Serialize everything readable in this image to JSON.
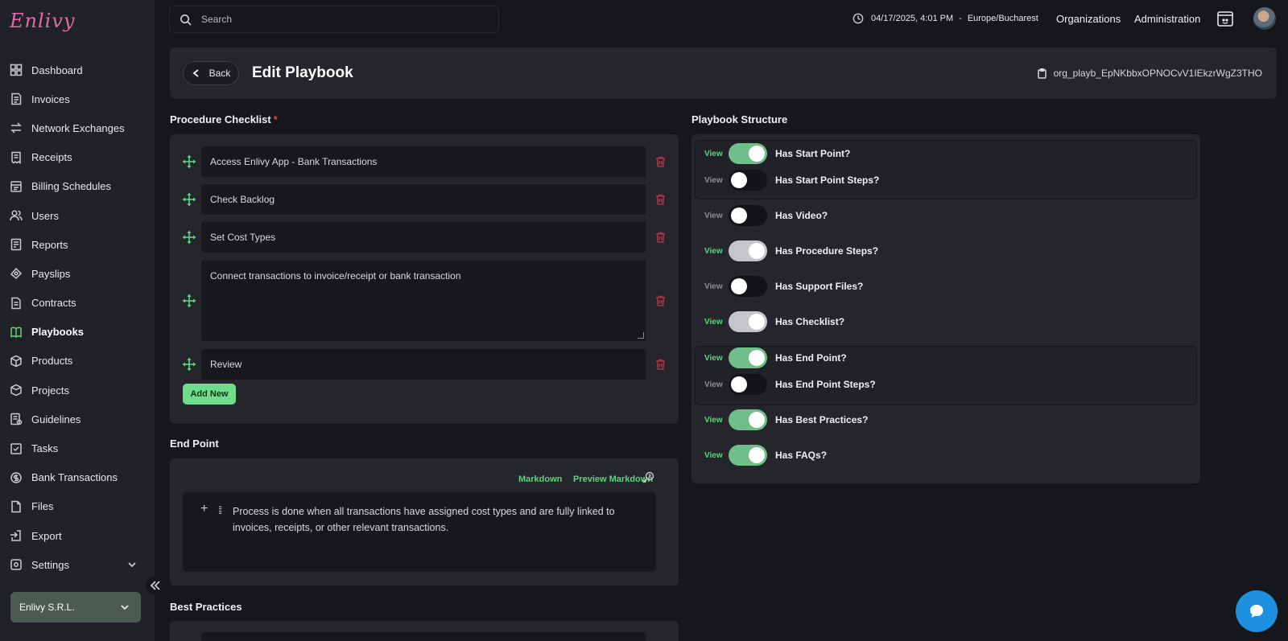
{
  "brand": {
    "logo_text": "Enlivy"
  },
  "sidebar": {
    "items": [
      {
        "label": "Dashboard",
        "icon": "dashboard-icon"
      },
      {
        "label": "Invoices",
        "icon": "invoice-icon"
      },
      {
        "label": "Network Exchanges",
        "icon": "exchange-icon"
      },
      {
        "label": "Receipts",
        "icon": "receipt-icon"
      },
      {
        "label": "Billing Schedules",
        "icon": "billing-icon"
      },
      {
        "label": "Users",
        "icon": "users-icon"
      },
      {
        "label": "Reports",
        "icon": "reports-icon"
      },
      {
        "label": "Payslips",
        "icon": "payslips-icon"
      },
      {
        "label": "Contracts",
        "icon": "contracts-icon"
      },
      {
        "label": "Playbooks",
        "icon": "playbooks-icon",
        "active": true
      },
      {
        "label": "Products",
        "icon": "products-icon"
      },
      {
        "label": "Projects",
        "icon": "projects-icon"
      },
      {
        "label": "Guidelines",
        "icon": "guidelines-icon"
      },
      {
        "label": "Tasks",
        "icon": "tasks-icon"
      },
      {
        "label": "Bank Transactions",
        "icon": "bank-icon"
      },
      {
        "label": "Files",
        "icon": "files-icon"
      },
      {
        "label": "Export",
        "icon": "export-icon"
      },
      {
        "label": "Settings",
        "icon": "settings-icon"
      }
    ],
    "organization": "Enlivy S.R.L."
  },
  "topbar": {
    "search_placeholder": "Search",
    "datetime": "04/17/2025, 4:01 PM",
    "separator": "-",
    "timezone": "Europe/Bucharest",
    "organizations_label": "Organizations",
    "administration_label": "Administration"
  },
  "header": {
    "back_label": "Back",
    "title": "Edit Playbook",
    "org_id": "org_playb_EpNKbbxOPNOCvV1IEkzrWgZ3THO"
  },
  "checklist": {
    "title": "Procedure Checklist",
    "required_mark": "*",
    "items": [
      "Access Enlivy App - Bank Transactions",
      "Check Backlog",
      "Set Cost Types",
      "Connect transactions to invoice/receipt or bank transaction",
      "Review"
    ],
    "add_label": "Add New"
  },
  "end_point": {
    "title": "End Point",
    "markdown_label": "Markdown",
    "preview_label": "Preview Markdown",
    "text": "Process is done when all transactions have assigned cost types and are fully linked to invoices, receipts, or other relevant transactions."
  },
  "best_practices": {
    "title": "Best Practices"
  },
  "structure": {
    "title": "Playbook Structure",
    "view_label": "View",
    "toggles": [
      {
        "label": "Has Start Point?",
        "state": "on"
      },
      {
        "label": "Has Start Point Steps?",
        "state": "off"
      },
      {
        "label": "Has Video?",
        "state": "off"
      },
      {
        "label": "Has Procedure Steps?",
        "state": "on-grey"
      },
      {
        "label": "Has Support Files?",
        "state": "off"
      },
      {
        "label": "Has Checklist?",
        "state": "on-grey"
      },
      {
        "label": "Has End Point?",
        "state": "on"
      },
      {
        "label": "Has End Point Steps?",
        "state": "off"
      },
      {
        "label": "Has Best Practices?",
        "state": "on"
      },
      {
        "label": "Has FAQs?",
        "state": "on"
      }
    ]
  },
  "colors": {
    "accent": "#5fd37f",
    "background": "#15171b",
    "card": "#24262b",
    "danger": "#b03048",
    "chat": "#1e90e0"
  }
}
